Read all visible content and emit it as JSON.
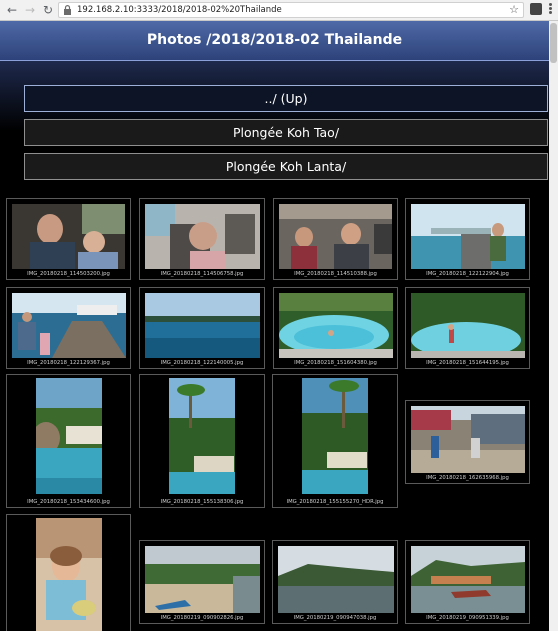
{
  "browser": {
    "url": "192.168.2.10:3333/2018/2018-02%20Thailande",
    "icons": [
      "back-arrow-icon",
      "forward-arrow-icon",
      "reload-icon",
      "lock-icon",
      "bookmark-star-icon",
      "extension-icon",
      "menu-dots-icon"
    ]
  },
  "header": {
    "title": "Photos /2018/2018-02 Thailande"
  },
  "folders": [
    {
      "label": "../ (Up)"
    },
    {
      "label": "Plongée Koh Tao/"
    },
    {
      "label": "Plongée Koh Lanta/"
    }
  ],
  "photos": [
    {
      "caption": "IMG_20180218_114503200.jpg"
    },
    {
      "caption": "IMG_20180218_114506758.jpg"
    },
    {
      "caption": "IMG_20180218_114510388.jpg"
    },
    {
      "caption": "IMG_20180218_122122904.jpg"
    },
    {
      "caption": "IMG_20180218_122129367.jpg"
    },
    {
      "caption": "IMG_20180218_122140005.jpg"
    },
    {
      "caption": "IMG_20180218_151604380.jpg"
    },
    {
      "caption": "IMG_20180218_151644195.jpg"
    },
    {
      "caption": "IMG_20180218_153434600.jpg"
    },
    {
      "caption": "IMG_20180218_155138306.jpg"
    },
    {
      "caption": "IMG_20180218_155155270_HDR.jpg"
    },
    {
      "caption": "IMG_20180218_162635968.jpg"
    },
    {
      "caption": ""
    },
    {
      "caption": "IMG_20180219_090902826.jpg"
    },
    {
      "caption": "IMG_20180219_090947038.jpg"
    },
    {
      "caption": "IMG_20180219_090951339.jpg"
    }
  ]
}
